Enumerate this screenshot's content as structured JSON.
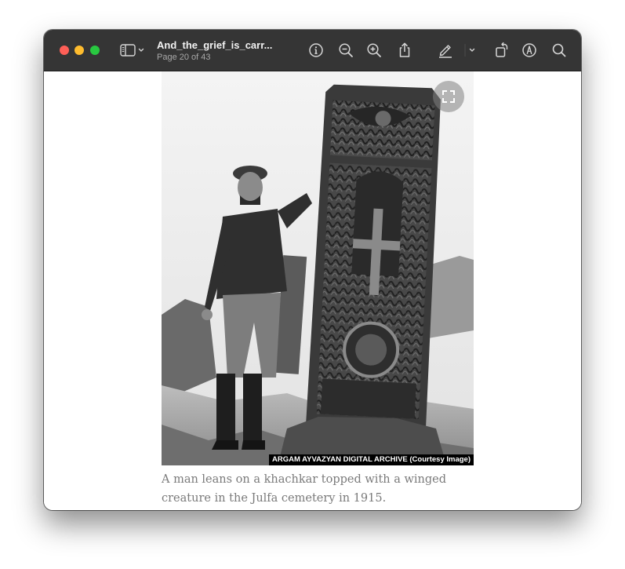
{
  "window": {
    "title": "And_the_grief_is_carr...",
    "subtitle": "Page 20 of 43"
  },
  "toolbar": {
    "icons": [
      "sidebar-icon",
      "chevron-down-icon",
      "info-icon",
      "zoom-out-icon",
      "zoom-in-icon",
      "share-icon",
      "highlight-pen-icon",
      "chevron-down-icon",
      "rotate-icon",
      "markup-icon",
      "search-icon"
    ]
  },
  "document": {
    "photo_credit": "ARGAM AYVAZYAN DIGITAL ARCHIVE (Courtesy Image)",
    "caption_line1": "A man leans on a khachkar topped with a winged",
    "caption_line2": "creature in the Julfa cemetery in 1915."
  },
  "colors": {
    "titlebar": "#353535",
    "close": "#fe5f57",
    "minimize": "#febc2e",
    "maximize": "#28c840",
    "caption_text": "#7a7a7a"
  }
}
